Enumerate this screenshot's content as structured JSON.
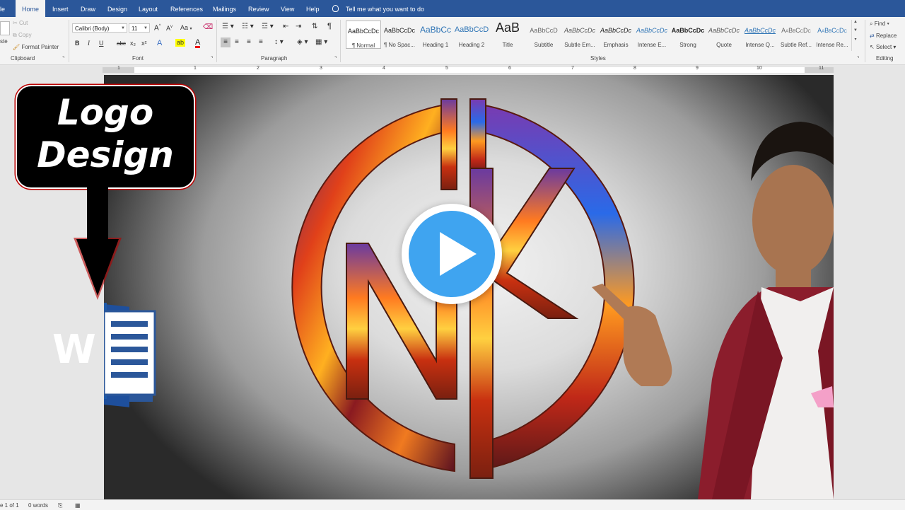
{
  "tabs": [
    "le",
    "Home",
    "Insert",
    "Draw",
    "Design",
    "Layout",
    "References",
    "Mailings",
    "Review",
    "View",
    "Help"
  ],
  "active_tab": "Home",
  "tell_me": "Tell me what you want to do",
  "clipboard": {
    "cut": "Cut",
    "copy": "Copy",
    "paste": "ste",
    "format_painter": "Format Painter",
    "label": "Clipboard"
  },
  "font": {
    "name": "Calibri (Body)",
    "size": "11",
    "label": "Font",
    "grow": "A",
    "shrink": "A",
    "case": "Aa",
    "bold": "B",
    "italic": "I",
    "underline": "U",
    "strike": "abc",
    "sub": "x₂",
    "sup": "x²"
  },
  "paragraph": {
    "label": "Paragraph",
    "pilcrow": "¶"
  },
  "styles": {
    "label": "Styles",
    "items": [
      {
        "preview": "AaBbCcDc",
        "name": "¶ Normal"
      },
      {
        "preview": "AaBbCcDc",
        "name": "¶ No Spac..."
      },
      {
        "preview": "AaBbCc",
        "name": "Heading 1"
      },
      {
        "preview": "AaBbCcD",
        "name": "Heading 2"
      },
      {
        "preview": "AaB",
        "name": "Title"
      },
      {
        "preview": "AaBbCcD",
        "name": "Subtitle"
      },
      {
        "preview": "AaBbCcDc",
        "name": "Subtle Em..."
      },
      {
        "preview": "AaBbCcDc",
        "name": "Emphasis"
      },
      {
        "preview": "AaBbCcDc",
        "name": "Intense E..."
      },
      {
        "preview": "AaBbCcDc",
        "name": "Strong"
      },
      {
        "preview": "AaBbCcDc",
        "name": "Quote"
      },
      {
        "preview": "AaBbCcDc",
        "name": "Intense Q..."
      },
      {
        "preview": "AaBbCcDc",
        "name": "Subtle Ref..."
      },
      {
        "preview": "AaBbCcDc",
        "name": "Intense Re..."
      }
    ]
  },
  "editing": {
    "find": "Find",
    "replace": "Replace",
    "select": "Select",
    "label": "Editing"
  },
  "ruler_numbers": [
    "1",
    "1",
    "2",
    "3",
    "4",
    "5",
    "6",
    "7",
    "8",
    "9",
    "10",
    "11"
  ],
  "callout": {
    "line1": "Logo",
    "line2": "Design"
  },
  "word_icon_letter": "W",
  "status": {
    "page": "e 1 of 1",
    "words": "0 words"
  },
  "colors": {
    "accent": "#2b579a",
    "play": "#3fa4f0",
    "jacket": "#8b1d2c"
  }
}
